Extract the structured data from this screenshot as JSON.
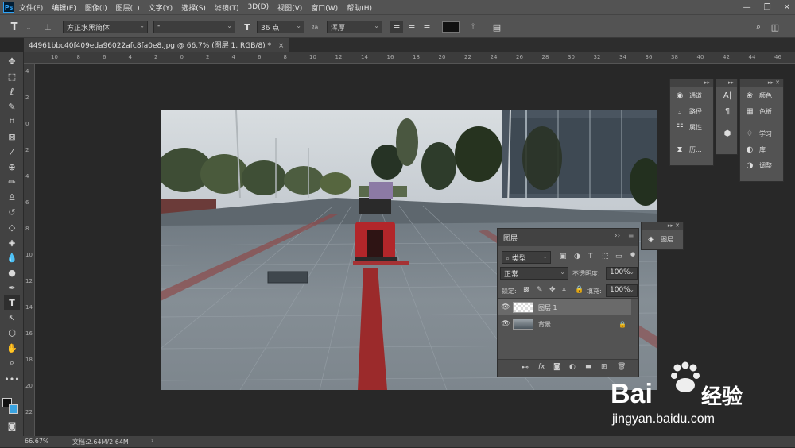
{
  "app": {
    "logo": "Ps"
  },
  "menu": [
    "文件(F)",
    "编辑(E)",
    "图像(I)",
    "图层(L)",
    "文字(Y)",
    "选择(S)",
    "滤镜(T)",
    "3D(D)",
    "视图(V)",
    "窗口(W)",
    "帮助(H)"
  ],
  "options": {
    "font_family": "方正水黑简体",
    "font_style": "-",
    "font_size": "36 点",
    "aa_label": "ªa",
    "aa_mode": "浑厚",
    "tool_icon": "T"
  },
  "tab": {
    "title": "44961bbc40f409eda96022afc8fa0e8.jpg @ 66.7% (图层 1, RGB/8) *",
    "close": "×"
  },
  "ruler": {
    "top": [
      "10",
      "8",
      "6",
      "4",
      "2",
      "0",
      "2",
      "4",
      "6",
      "8",
      "10",
      "12",
      "14",
      "16",
      "18",
      "20",
      "22",
      "24",
      "26",
      "28",
      "30",
      "32",
      "34",
      "36",
      "38",
      "40",
      "42",
      "44",
      "46"
    ],
    "left": [
      "4",
      "2",
      "0",
      "2",
      "4",
      "6",
      "8",
      "10",
      "12",
      "14",
      "16",
      "18",
      "20",
      "22"
    ]
  },
  "status": {
    "zoom": "66.67%",
    "doc": "文档:2.64M/2.64M",
    "arrow": "›"
  },
  "panels": {
    "group1": [
      {
        "icon": "channels-icon",
        "label": "通道"
      },
      {
        "icon": "paths-icon",
        "label": "路径"
      },
      {
        "icon": "properties-icon",
        "label": "属性"
      },
      {
        "icon": "history-icon",
        "label": "历..."
      }
    ],
    "group3": [
      {
        "icon": "color-icon",
        "label": "颜色"
      },
      {
        "icon": "swatches-icon",
        "label": "色板"
      },
      {
        "icon": "learn-icon",
        "label": "学习"
      },
      {
        "icon": "library-icon",
        "label": "库"
      },
      {
        "icon": "adjustments-icon",
        "label": "调整"
      }
    ],
    "layers_tab": "图层",
    "layers_mini": "图层"
  },
  "layers": {
    "filter": "类型",
    "blend": "正常",
    "opacity_label": "不透明度:",
    "opacity": "100%",
    "lock_label": "锁定:",
    "fill_label": "填充:",
    "fill": "100%",
    "items": [
      {
        "name": "图层 1",
        "selected": true
      },
      {
        "name": "背景",
        "locked": true
      }
    ]
  },
  "watermark": {
    "brand": "Bai",
    "brand2": "经验",
    "url": "jingyan.baidu.com"
  }
}
